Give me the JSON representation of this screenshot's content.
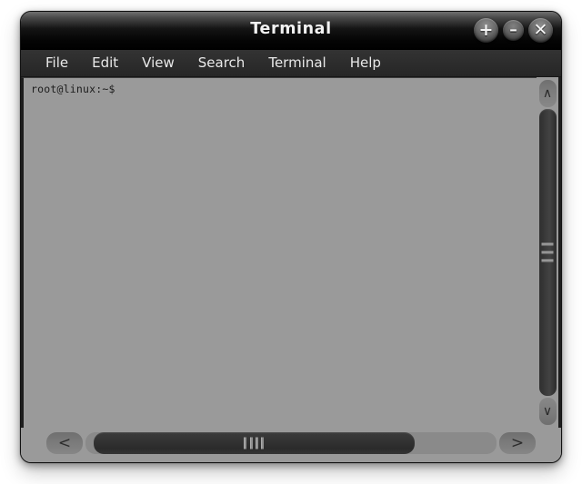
{
  "window": {
    "title": "Terminal",
    "controls": [
      {
        "name": "maximize-button",
        "glyph": "+"
      },
      {
        "name": "minimize-button",
        "glyph": "–"
      },
      {
        "name": "close-button",
        "glyph": "✕"
      }
    ],
    "frame_color": "#121212",
    "titlebar_color": "#000000",
    "menubar_color": "#2c2c2c",
    "body_color": "#9a9a9a"
  },
  "menubar": {
    "items": [
      {
        "label": "File"
      },
      {
        "label": "Edit"
      },
      {
        "label": "View"
      },
      {
        "label": "Search"
      },
      {
        "label": "Terminal"
      },
      {
        "label": "Help"
      }
    ]
  },
  "terminal": {
    "prompt": "root@linux:~$",
    "text_color": "#1c1c1c",
    "background_color": "#9a9a9a"
  },
  "scrollbars": {
    "vertical": {
      "up_arrow": "∧",
      "down_arrow": "∨",
      "thumb_grip_lines": 3
    },
    "horizontal": {
      "left_arrow": "<",
      "right_arrow": ">",
      "thumb_grip_lines": 4
    }
  }
}
